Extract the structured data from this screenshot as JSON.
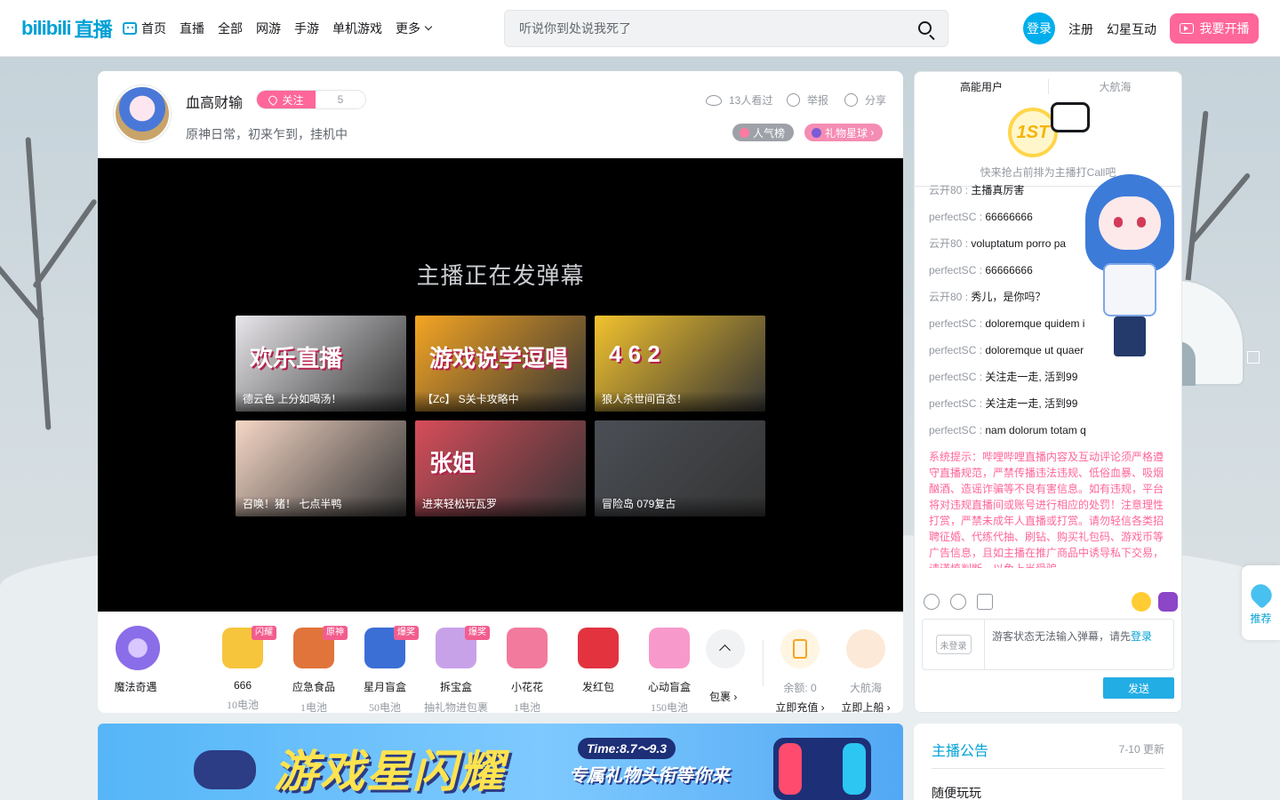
{
  "header": {
    "logo_text": "bilibili",
    "logo_suffix": "直播",
    "nav": [
      "首页",
      "直播",
      "全部",
      "网游",
      "手游",
      "单机游戏",
      "更多"
    ],
    "search_placeholder": "听说你到处说我死了",
    "login": "登录",
    "register": "注册",
    "username": "幻星互动",
    "start_live": "我要开播"
  },
  "room": {
    "anchor_name": "血高财输",
    "follow_label": "关注",
    "follow_count": "5",
    "title": "原神日常，初来乍到，挂机中",
    "viewers": "13人看过",
    "report": "举报",
    "share": "分享",
    "popularity": "人气榜",
    "gift_planet": "礼物星球"
  },
  "video": {
    "status_text": "主播正在发弹幕",
    "recommendations": [
      {
        "caption": "德云色 上分如喝汤！",
        "art": "欢乐直播",
        "color": "#e8e6ea"
      },
      {
        "caption": "【Zc】 S关卡攻略中",
        "art": "游戏说学逗唱",
        "color": "#f5a523"
      },
      {
        "caption": "狼人杀世间百态！",
        "art": "4 6 2",
        "color": "#f2c22e"
      },
      {
        "caption": "召唤！猪！ 七点半鸭",
        "art": "",
        "color": "#f6d7c6"
      },
      {
        "caption": "进来轻松玩瓦罗",
        "art": "张姐",
        "color": "#d64d5a"
      },
      {
        "caption": "冒险岛 079复古",
        "art": "",
        "color": "#4b4f55"
      }
    ]
  },
  "gifts": {
    "magic_label": "魔法奇遇",
    "items": [
      {
        "name": "666",
        "price": "10电池",
        "tag": "闪耀",
        "color": "#f6c53c"
      },
      {
        "name": "应急食品",
        "price": "1电池",
        "tag": "原神",
        "color": "#e0743a"
      },
      {
        "name": "星月盲盒",
        "price": "50电池",
        "tag": "爆奖",
        "color": "#3b6fd6"
      },
      {
        "name": "拆宝盒",
        "price": "抽礼物进包裹",
        "tag": "爆奖",
        "color": "#c8a2e8"
      },
      {
        "name": "小花花",
        "price": "1电池",
        "tag": "",
        "color": "#f27a9c"
      },
      {
        "name": "发红包",
        "price": "",
        "tag": "",
        "color": "#e2333f"
      },
      {
        "name": "心动盲盒",
        "price": "150电池",
        "tag": "",
        "color": "#f79acb"
      }
    ],
    "bag_label": "包裹",
    "balance": "余额: 0",
    "recharge": "立即充值",
    "guard": "大航海",
    "board": "立即上船"
  },
  "side": {
    "tab_high": "高能用户",
    "tab_guard": "大航海",
    "rank_badge": "1ST",
    "rank_hint": "快来抢占前排为主播打Call吧",
    "messages": [
      {
        "user": "云开80",
        "text": "主播真厉害"
      },
      {
        "user": "perfectSC",
        "text": "66666666"
      },
      {
        "user": "云开80",
        "text": "voluptatum porro pa"
      },
      {
        "user": "perfectSC",
        "text": "66666666"
      },
      {
        "user": "云开80",
        "text": "秀儿，是你吗？"
      },
      {
        "user": "perfectSC",
        "text": "doloremque quidem i"
      },
      {
        "user": "perfectSC",
        "text": "doloremque ut quaer"
      },
      {
        "user": "perfectSC",
        "text": "关注走一走, 活到99"
      },
      {
        "user": "perfectSC",
        "text": "关注走一走, 活到99"
      },
      {
        "user": "perfectSC",
        "text": "nam dolorum totam q"
      }
    ],
    "system_notice": "系统提示：哔哩哔哩直播内容及互动评论须严格遵守直播规范，严禁传播违法违规、低俗血暴、吸烟酗酒、造谣诈骗等不良有害信息。如有违规，平台将对违规直播间或账号进行相应的处罚！注意理性打赏，严禁未成年人直播或打赏。请勿轻信各类招聘征婚、代练代抽、刷钻、购买礼包码、游戏币等广告信息，且如主播在推广商品中诱导私下交易，请谨慎判断，以免上当受骗。",
    "not_logged": "未登录",
    "input_hint": "游客状态无法输入弹幕，请先",
    "input_login": "登录",
    "send": "发送"
  },
  "float": {
    "recommend": "推荐"
  },
  "banner": {
    "title": "游戏星闪耀",
    "time": "Time:8.7～9.3",
    "subtitle": "专属礼物头衔等你来"
  },
  "notice": {
    "title": "主播公告",
    "date": "7-10 更新",
    "content": "随便玩玩"
  }
}
